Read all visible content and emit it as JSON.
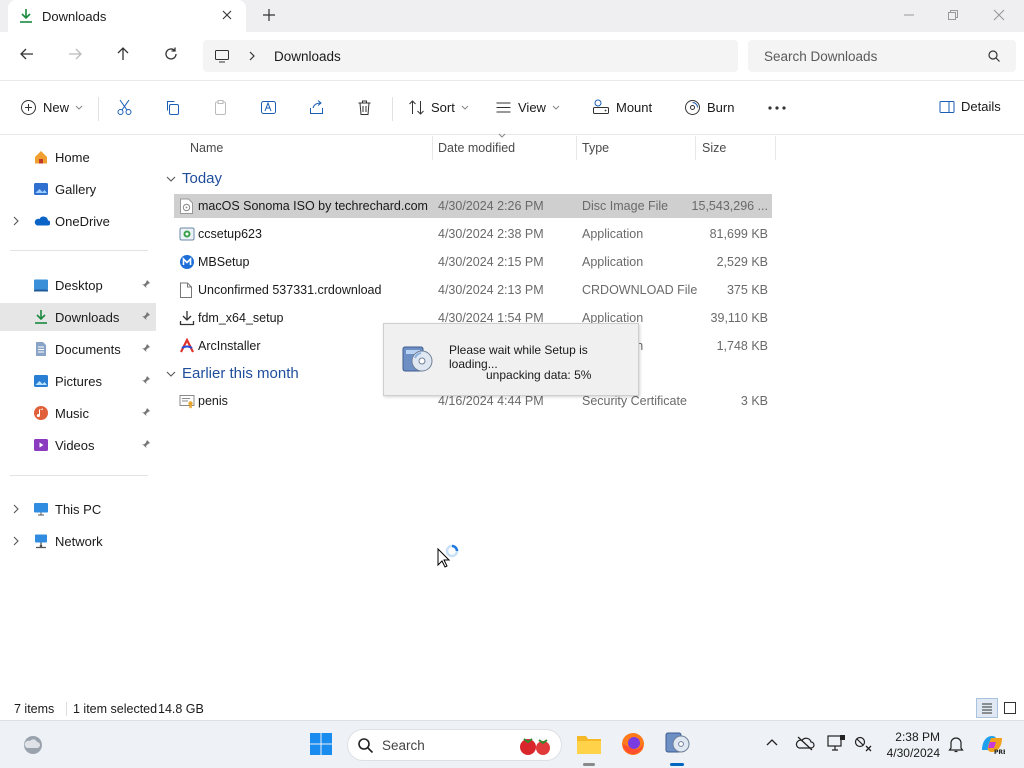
{
  "window": {
    "tab_title": "Downloads",
    "new_tab": "+"
  },
  "address": {
    "path_segment": "Downloads",
    "search_placeholder": "Search Downloads"
  },
  "toolbar": {
    "new_label": "New",
    "sort_label": "Sort",
    "view_label": "View",
    "mount_label": "Mount",
    "burn_label": "Burn",
    "details_label": "Details"
  },
  "sidebar": {
    "items": [
      {
        "label": "Home",
        "icon": "home-icon"
      },
      {
        "label": "Gallery",
        "icon": "gallery-icon"
      },
      {
        "label": "OneDrive",
        "icon": "onedrive-icon"
      },
      {
        "label": "Desktop",
        "icon": "desktop-icon"
      },
      {
        "label": "Downloads",
        "icon": "downloads-icon"
      },
      {
        "label": "Documents",
        "icon": "documents-icon"
      },
      {
        "label": "Pictures",
        "icon": "pictures-icon"
      },
      {
        "label": "Music",
        "icon": "music-icon"
      },
      {
        "label": "Videos",
        "icon": "videos-icon"
      },
      {
        "label": "This PC",
        "icon": "this-pc-icon"
      },
      {
        "label": "Network",
        "icon": "network-icon"
      }
    ]
  },
  "columns": {
    "name": "Name",
    "date": "Date modified",
    "type": "Type",
    "size": "Size"
  },
  "groups": {
    "today": "Today",
    "earlier": "Earlier this month"
  },
  "files": [
    {
      "name": "macOS Sonoma ISO by techrechard.com",
      "date": "4/30/2024 2:26 PM",
      "type": "Disc Image File",
      "size": "15,543,296 ...",
      "icon": "disc-image-icon"
    },
    {
      "name": "ccsetup623",
      "date": "4/30/2024 2:38 PM",
      "type": "Application",
      "size": "81,699 KB",
      "icon": "installer-icon"
    },
    {
      "name": "MBSetup",
      "date": "4/30/2024 2:15 PM",
      "type": "Application",
      "size": "2,529 KB",
      "icon": "malwarebytes-icon"
    },
    {
      "name": "Unconfirmed 537331.crdownload",
      "date": "4/30/2024 2:13 PM",
      "type": "CRDOWNLOAD File",
      "size": "375 KB",
      "icon": "blank-file-icon"
    },
    {
      "name": "fdm_x64_setup",
      "date": "4/30/2024 1:54 PM",
      "type": "Application",
      "size": "39,110 KB",
      "icon": "download-arrow-icon"
    },
    {
      "name": "ArcInstaller",
      "date": "",
      "type": "Application",
      "size": "1,748 KB",
      "icon": "arc-icon"
    },
    {
      "name": "penis",
      "date": "4/16/2024 4:44 PM",
      "type": "Security Certificate",
      "size": "3 KB",
      "icon": "certificate-icon"
    }
  ],
  "popup": {
    "message": "Please wait while Setup is loading...",
    "progress": "unpacking data: 5%"
  },
  "status": {
    "item_count": "7 items",
    "selection": "1 item selected",
    "selection_size": "14.8 GB"
  },
  "taskbar": {
    "search_label": "Search",
    "time": "2:38 PM",
    "date": "4/30/2024"
  },
  "colors": {
    "accent": "#0067c0",
    "selection": "#cfcfcf",
    "group_header": "#1f4e9c"
  }
}
